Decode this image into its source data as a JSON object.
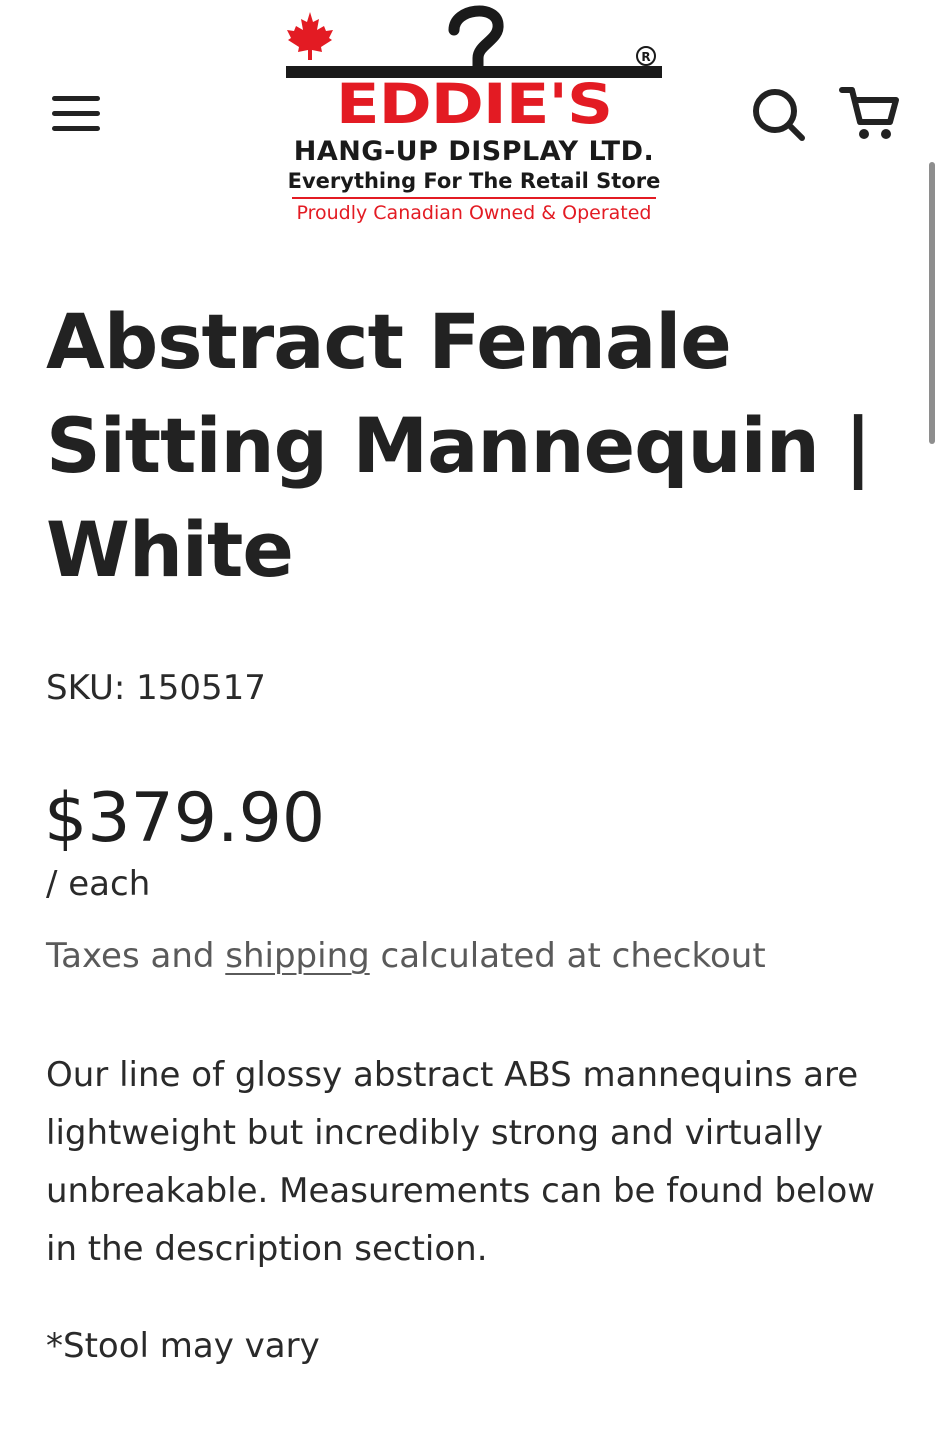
{
  "header": {
    "logo": {
      "brand": "EDDIE'S",
      "line1": "HANG-UP DISPLAY LTD.",
      "line2": "Everything For The Retail Store",
      "line3": "Proudly Canadian Owned & Operated"
    },
    "icons": {
      "menu": "hamburger-menu-icon",
      "search": "search-icon",
      "cart": "cart-icon",
      "maple_leaf": "maple-leaf-icon",
      "hanger": "hanger-icon"
    }
  },
  "colors": {
    "brand_red": "#e31b23",
    "text_dark": "#222222",
    "text_muted": "#5a5a5a"
  },
  "product": {
    "title": "Abstract Female Sitting Mannequin | White",
    "sku": "SKU: 150517",
    "price": "$379.90",
    "unit": "/ each",
    "tax_note": {
      "before": "Taxes and ",
      "link": "shipping",
      "after": " calculated at checkout"
    },
    "description": "Our line of glossy abstract ABS mannequins are lightweight but incredibly strong and virtually unbreakable. Measurements can be found below in the description section.",
    "stool_note": "*Stool may vary"
  }
}
